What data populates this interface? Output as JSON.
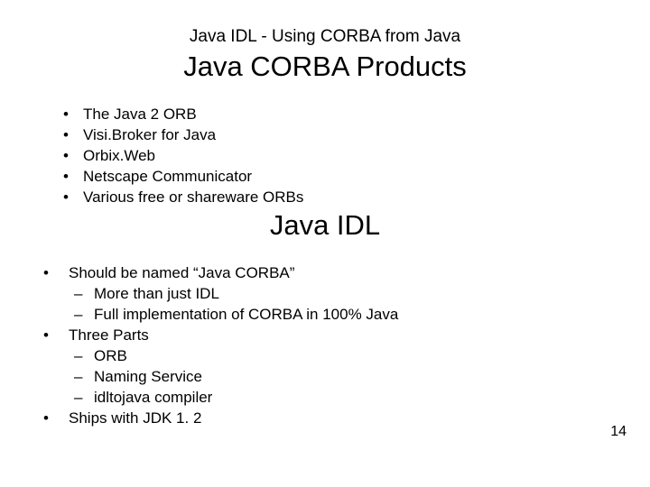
{
  "supratitle": "Java IDL - Using CORBA from Java",
  "title1": "Java CORBA Products",
  "list1": [
    "The Java 2 ORB",
    "Visi.Broker for Java",
    "Orbix.Web",
    "Netscape Communicator",
    "Various free or shareware ORBs"
  ],
  "title2": "Java IDL",
  "list2": [
    {
      "text": "Should be named “Java CORBA”",
      "sub": [
        "More than just IDL",
        "Full implementation of CORBA in 100% Java"
      ]
    },
    {
      "text": "Three Parts",
      "sub": [
        "ORB",
        "Naming Service",
        "idltojava compiler"
      ]
    },
    {
      "text": "Ships with JDK 1. 2",
      "sub": []
    }
  ],
  "page_number": "14"
}
